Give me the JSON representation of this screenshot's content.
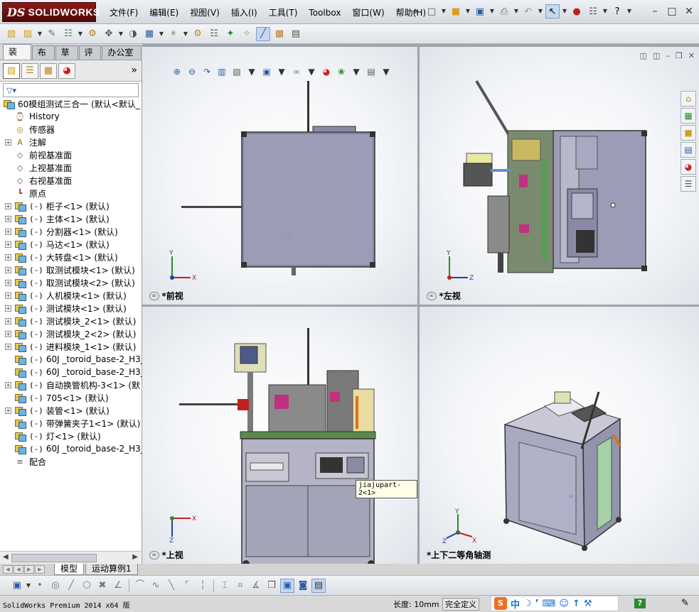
{
  "app": {
    "logo_ds": "DS",
    "logo_text": "SOLIDWORKS",
    "menu": [
      "文件(F)",
      "编辑(E)",
      "视图(V)",
      "插入(I)",
      "工具(T)",
      "Toolbox",
      "窗口(W)",
      "帮助(H)"
    ]
  },
  "command_tabs": [
    "装配体",
    "布局",
    "草图",
    "评估",
    "办公室产品"
  ],
  "tree": {
    "root": "60模组测试三合一  (默认<默认_",
    "items": [
      {
        "label": "History",
        "icon": "history-icon",
        "expand": false
      },
      {
        "label": "传感器",
        "icon": "sensor-icon",
        "expand": false
      },
      {
        "label": "注解",
        "icon": "annotation-icon",
        "expand": true
      },
      {
        "label": "前视基准面",
        "icon": "plane-icon",
        "expand": false
      },
      {
        "label": "上视基准面",
        "icon": "plane-icon",
        "expand": false
      },
      {
        "label": "右视基准面",
        "icon": "plane-icon",
        "expand": false
      },
      {
        "label": "原点",
        "icon": "origin-icon",
        "expand": false
      },
      {
        "state": "(-)",
        "label": "柜子<1> (默认)",
        "icon": "component-icon",
        "expand": true
      },
      {
        "state": "(-)",
        "label": "主体<1> (默认)",
        "icon": "component-icon",
        "expand": true
      },
      {
        "state": "(-)",
        "label": "分割器<1> (默认)",
        "icon": "component-icon",
        "expand": true
      },
      {
        "state": "(-)",
        "label": "马达<1> (默认)",
        "icon": "component-icon",
        "expand": true
      },
      {
        "state": "(-)",
        "label": "大转盘<1> (默认)",
        "icon": "component-icon",
        "expand": true
      },
      {
        "state": "(-)",
        "label": "取测试模块<1> (默认)",
        "icon": "component-icon",
        "expand": true
      },
      {
        "state": "(-)",
        "label": "取测试模块<2> (默认)",
        "icon": "component-icon",
        "expand": true
      },
      {
        "state": "(-)",
        "label": "人机模块<1> (默认)",
        "icon": "component-icon",
        "expand": true
      },
      {
        "state": "(-)",
        "label": "测试模块<1> (默认)",
        "icon": "component-icon",
        "expand": true
      },
      {
        "state": "(-)",
        "label": "测试模块_2<1> (默认)",
        "icon": "component-icon",
        "expand": true
      },
      {
        "state": "(-)",
        "label": "测试模块_2<2> (默认)",
        "icon": "component-icon",
        "expand": true
      },
      {
        "state": "(-)",
        "label": "进料模块_1<1> (默认)",
        "icon": "component-icon",
        "expand": true
      },
      {
        "state": "(-)",
        "label": "60J _toroid_base-2_H3_",
        "icon": "component-icon",
        "expand": false
      },
      {
        "state": "(-)",
        "label": "60J _toroid_base-2_H3_",
        "icon": "component-icon",
        "expand": false
      },
      {
        "state": "(-)",
        "label": "自动换管机构-3<1> (默",
        "icon": "component-icon",
        "expand": true
      },
      {
        "state": "(-)",
        "label": "705<1> (默认)",
        "icon": "component-icon",
        "expand": false
      },
      {
        "state": "(-)",
        "label": "装管<1> (默认)",
        "icon": "component-icon",
        "expand": true
      },
      {
        "state": "(-)",
        "label": "带弹簧夹子1<1> (默认)",
        "icon": "component-icon",
        "expand": false
      },
      {
        "state": "(-)",
        "label": "灯<1> (默认)",
        "icon": "component-icon",
        "expand": false
      },
      {
        "state": "(-)",
        "label": "60J _toroid_base-2_H3_",
        "icon": "component-icon",
        "expand": false
      },
      {
        "label": "配合",
        "icon": "mates-icon",
        "expand": false
      }
    ]
  },
  "viewports": {
    "front": "*前视",
    "left": "*左视",
    "top": "*上视",
    "iso": "*上下二等角轴测"
  },
  "axes": {
    "x": "X",
    "y": "Y",
    "z": "Z"
  },
  "tooltip": "jiajupart-2<1>",
  "bottom_tabs": [
    "模型",
    "运动算例1"
  ],
  "status": {
    "product": "SolidWorks Premium 2014 x64 版",
    "length": "长度: 10mm",
    "defined": "完全定义",
    "ime_label": "中"
  }
}
